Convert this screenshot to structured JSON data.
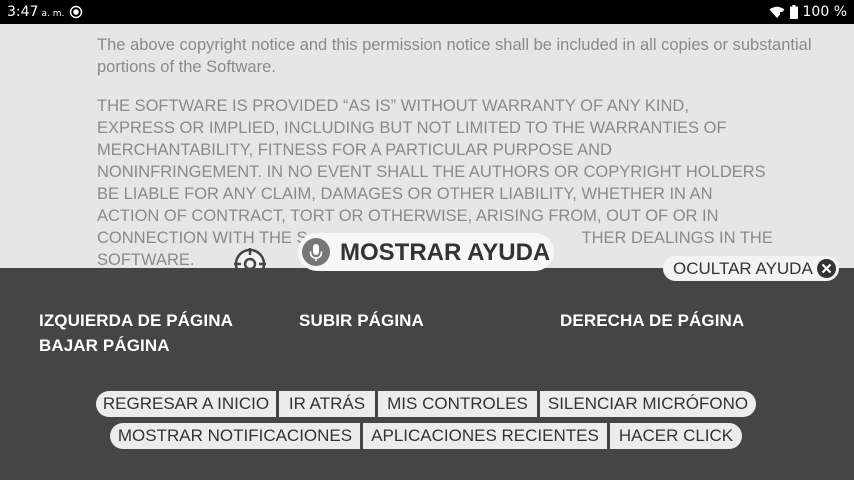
{
  "status_bar": {
    "time": "3:47",
    "ampm": "a. m.",
    "battery": "100 %",
    "icons": [
      "sync-icon",
      "wifi-icon",
      "battery-icon"
    ]
  },
  "document": {
    "paragraph1": "The above copyright notice and this permission notice shall be included in all copies or substantial portions of the Software.",
    "paragraph2_lines": [
      "THE SOFTWARE IS PROVIDED “AS IS” WITHOUT WARRANTY OF ANY KIND,",
      "EXPRESS OR IMPLIED, INCLUDING BUT NOT LIMITED TO THE WARRANTIES OF",
      "MERCHANTABILITY, FITNESS FOR A PARTICULAR PURPOSE AND",
      "NONINFRINGEMENT. IN NO EVENT SHALL THE AUTHORS OR COPYRIGHT HOLDERS",
      "BE LIABLE FOR ANY CLAIM, DAMAGES OR OTHER LIABILITY, WHETHER IN AN",
      "ACTION OF CONTRACT, TORT OR OTHERWISE, ARISING FROM, OUT OF OR IN",
      "CONNECTION WITH THE S",
      "THER DEALINGS IN THE",
      "SOFTWARE."
    ]
  },
  "voice_overlay": {
    "show_help": "MOSTRAR AYUDA",
    "hide_help": "OCULTAR AYUDA",
    "commands": {
      "page_left": "IZQUIERDA DE PÁGINA",
      "page_up": "SUBIR PÁGINA",
      "page_right": "DERECHA DE PÁGINA",
      "page_down": "BAJAR PÁGINA"
    },
    "buttons_row1": [
      "REGRESAR A INICIO",
      "IR ATRÁS",
      "MIS CONTROLES",
      "SILENCIAR MICRÓFONO"
    ],
    "buttons_row2": [
      "MOSTRAR NOTIFICACIONES",
      "APLICACIONES RECIENTES",
      "HACER CLICK"
    ]
  },
  "colors": {
    "overlay_bg": "#454545",
    "doc_text": "#8a8a8a",
    "pill_bg": "#ececec"
  }
}
